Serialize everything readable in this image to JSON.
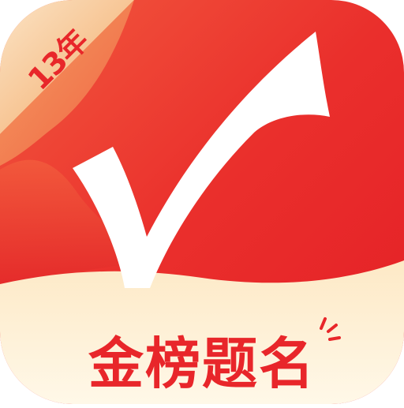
{
  "app_icon": {
    "badge_text": "13年",
    "slogan": "金榜题名",
    "icon": "checkmark-icon"
  },
  "colors": {
    "red_dark": "#e8202a",
    "red_light": "#f06a4a",
    "orange_corner": "#f58a3a",
    "cream_banner": "#fff4dc",
    "check_white": "#ffffff",
    "text_red": "#e8262a"
  }
}
